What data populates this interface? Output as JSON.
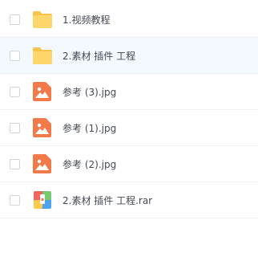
{
  "files": [
    {
      "name": "1.视频教程",
      "type": "folder",
      "icon": "folder-icon"
    },
    {
      "name": "2.素材 插件 工程",
      "type": "folder",
      "icon": "folder-icon",
      "highlighted": true
    },
    {
      "name": "参考 (3).jpg",
      "type": "image",
      "icon": "image-icon"
    },
    {
      "name": "参考 (1).jpg",
      "type": "image",
      "icon": "image-icon"
    },
    {
      "name": "参考 (2).jpg",
      "type": "image",
      "icon": "image-icon"
    },
    {
      "name": "2.素材 插件 工程.rar",
      "type": "archive",
      "icon": "archive-icon"
    }
  ],
  "colors": {
    "folder": "#ffd66b",
    "folder_tab": "#f7c44a",
    "image": "#f27a4a",
    "row_highlight": "#f3f9fe",
    "text": "#444a52"
  }
}
